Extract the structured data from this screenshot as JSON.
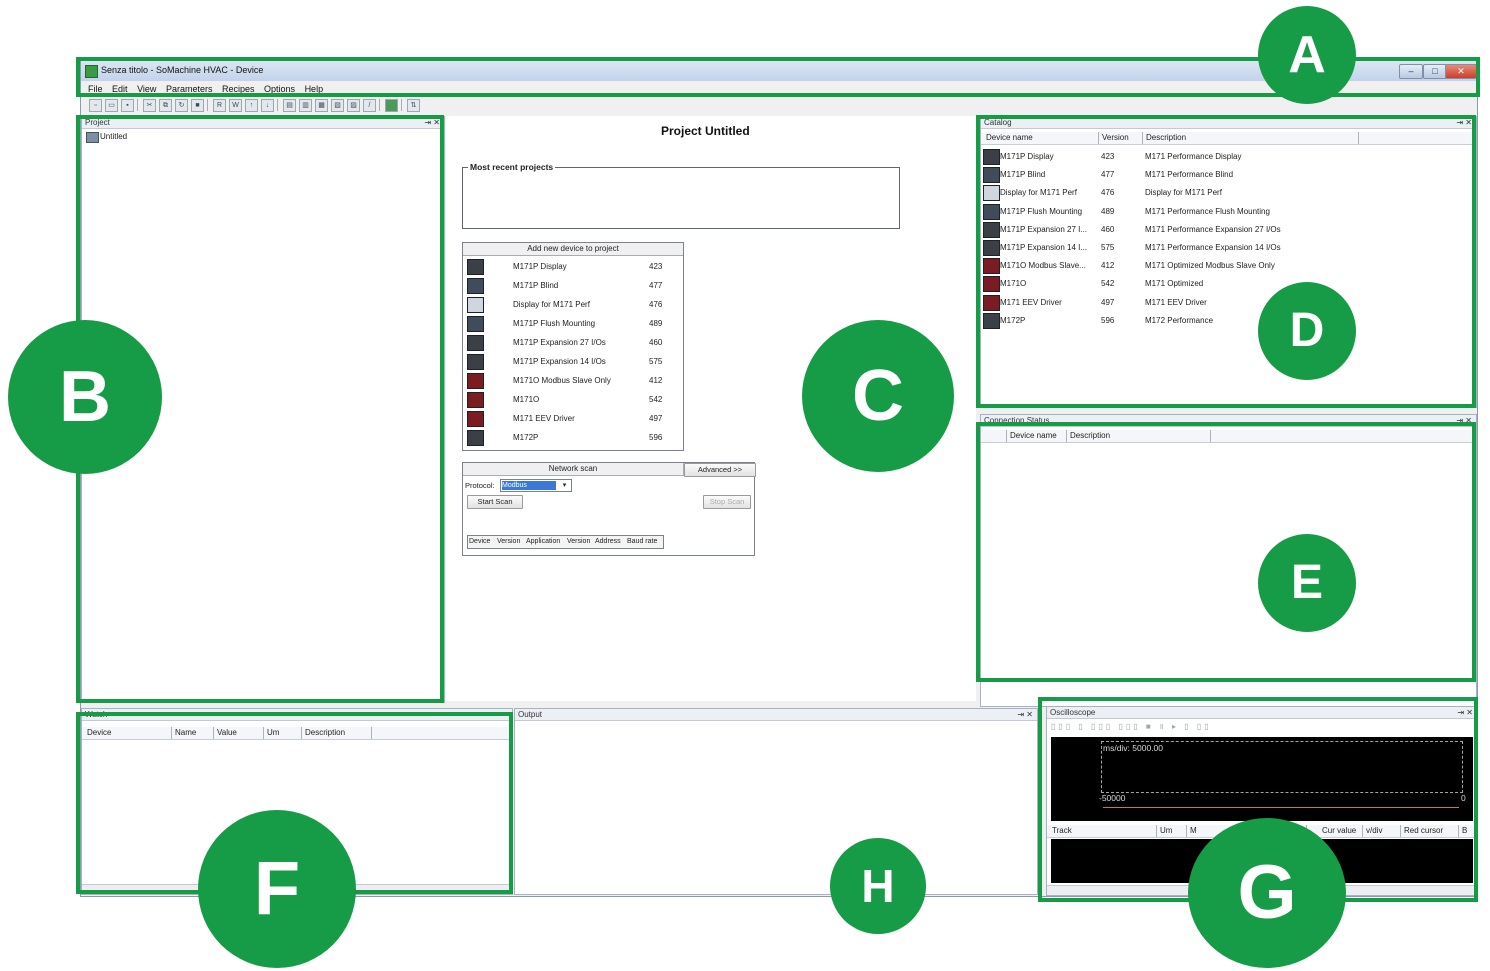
{
  "window": {
    "title": "Senza titolo - SoMachine HVAC - Device",
    "min_label": "–",
    "max_label": "□",
    "close_label": "✕"
  },
  "menu": [
    "File",
    "Edit",
    "View",
    "Parameters",
    "Recipes",
    "Options",
    "Help"
  ],
  "project_panel": {
    "title": "Project",
    "pin": "⇥ ✕",
    "tree_item": "Untitled"
  },
  "center": {
    "title": "Project Untitled",
    "recent_label": "Most recent projects",
    "add_device_header": "Add new device to project",
    "devices": [
      {
        "name": "M171P Display",
        "version": "423",
        "icon": "dark"
      },
      {
        "name": "M171P Blind",
        "version": "477",
        "icon": "wide"
      },
      {
        "name": "Display for M171 Perf",
        "version": "476",
        "icon": "light"
      },
      {
        "name": "M171P Flush Mounting",
        "version": "489",
        "icon": "wide"
      },
      {
        "name": "M171P Expansion 27 I/Os",
        "version": "460",
        "icon": "dark"
      },
      {
        "name": "M171P Expansion 14 I/Os",
        "version": "575",
        "icon": "dark"
      },
      {
        "name": "M171O Modbus Slave Only",
        "version": "412",
        "icon": "red"
      },
      {
        "name": "M171O",
        "version": "542",
        "icon": "red"
      },
      {
        "name": "M171 EEV Driver",
        "version": "497",
        "icon": "red"
      },
      {
        "name": "M172P",
        "version": "596",
        "icon": "dark"
      }
    ],
    "network_scan": {
      "title": "Network scan",
      "advanced": "Advanced >>",
      "protocol_label": "Protocol:",
      "protocol_value": "Modbus",
      "start_scan": "Start Scan",
      "stop_scan": "Stop Scan",
      "columns": [
        "Device",
        "Version",
        "Application",
        "Version",
        "Address",
        "Baud rate"
      ]
    }
  },
  "catalog": {
    "title": "Catalog",
    "pin": "⇥ ✕",
    "columns": [
      "Device name",
      "Version",
      "Description"
    ],
    "rows": [
      {
        "name": "M171P Display",
        "version": "423",
        "description": "M171 Performance Display",
        "icon": "dark"
      },
      {
        "name": "M171P Blind",
        "version": "477",
        "description": "M171 Performance Blind",
        "icon": "wide"
      },
      {
        "name": "Display for M171 Perf",
        "version": "476",
        "description": "Display for M171 Perf",
        "icon": "light"
      },
      {
        "name": "M171P Flush Mounting",
        "version": "489",
        "description": "M171 Performance Flush Mounting",
        "icon": "wide"
      },
      {
        "name": "M171P Expansion 27 I...",
        "version": "460",
        "description": "M171 Performance Expansion 27 I/Os",
        "icon": "dark"
      },
      {
        "name": "M171P Expansion 14 I...",
        "version": "575",
        "description": "M171 Performance Expansion 14 I/Os",
        "icon": "dark"
      },
      {
        "name": "M171O Modbus Slave...",
        "version": "412",
        "description": "M171 Optimized Modbus Slave Only",
        "icon": "red"
      },
      {
        "name": "M171O",
        "version": "542",
        "description": "M171 Optimized",
        "icon": "red"
      },
      {
        "name": "M171 EEV Driver",
        "version": "497",
        "description": "M171 EEV Driver",
        "icon": "red"
      },
      {
        "name": "M172P",
        "version": "596",
        "description": "M172 Performance",
        "icon": "dark"
      }
    ]
  },
  "connection_status": {
    "title": "Connection Status",
    "pin": "⇥ ✕",
    "columns": [
      "Device name",
      "Description"
    ]
  },
  "watch": {
    "title": "Watch",
    "columns": [
      "Device",
      "Name",
      "Value",
      "Um",
      "Description"
    ]
  },
  "output": {
    "title": "Output",
    "pin": "⇥ ✕"
  },
  "oscilloscope": {
    "title": "Oscilloscope",
    "pin": "⇥ ✕",
    "ms_div": "ms/div: 5000.00",
    "axis_left": "-50000",
    "axis_right": "0",
    "columns": [
      "Track",
      "Um",
      "M",
      "Cur value",
      "v/div",
      "Red cursor",
      "B"
    ]
  },
  "annotations": {
    "A": "A",
    "B": "B",
    "C": "C",
    "D": "D",
    "E": "E",
    "F": "F",
    "G": "G",
    "H": "H",
    "color": "#169b47"
  }
}
